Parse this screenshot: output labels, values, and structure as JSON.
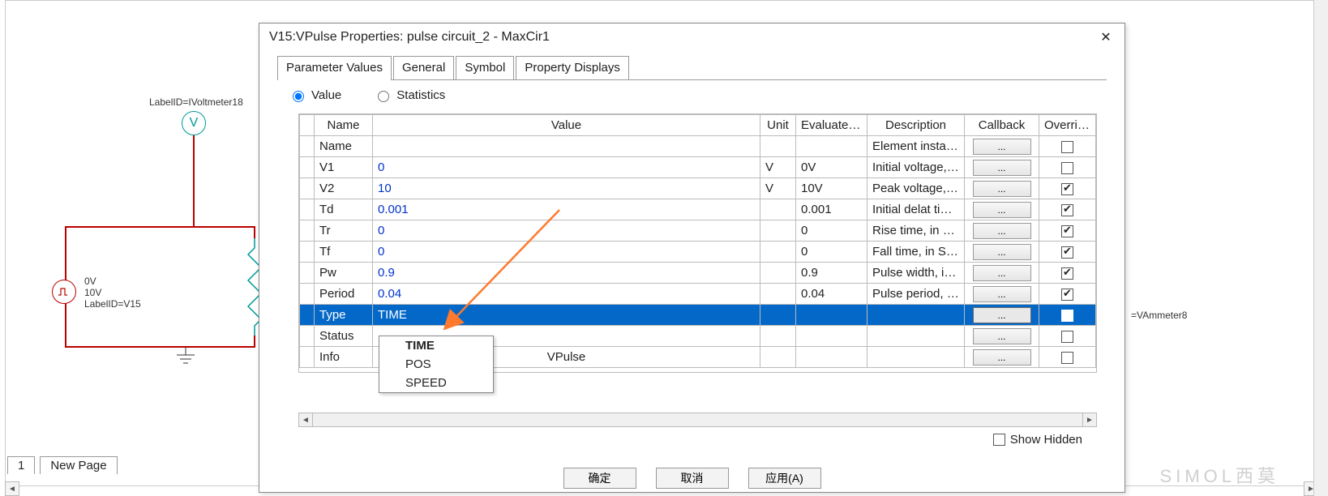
{
  "canvas": {
    "voltmeter_label": "LabelID=IVoltmeter18",
    "voltmeter_symbol": "V",
    "source_lines": [
      "0V",
      "10V",
      "LabelID=V15"
    ],
    "vammeter_label": "=VAmmeter8"
  },
  "bottom_tabs": {
    "tab1": "1",
    "tab2": "New Page"
  },
  "watermark": "SIMOL西莫",
  "dialog": {
    "title": "V15:VPulse Properties: pulse circuit_2 - MaxCir1",
    "close": "✕",
    "tabs": {
      "t0": "Parameter Values",
      "t1": "General",
      "t2": "Symbol",
      "t3": "Property Displays"
    },
    "radios": {
      "value": "Value",
      "stats": "Statistics"
    },
    "headers": {
      "name": "Name",
      "value": "Value",
      "unit": "Unit",
      "eval": "Evaluated...",
      "desc": "Description",
      "cb": "Callback",
      "ovr": "Override"
    },
    "rows": [
      {
        "name": "Name",
        "value": "",
        "unit": "",
        "eval": "",
        "desc": "Element instan...",
        "cb": "...",
        "ovr": false,
        "blue": false
      },
      {
        "name": "V1",
        "value": "0",
        "unit": "V",
        "eval": "0V",
        "desc": "Initial voltage, ...",
        "cb": "...",
        "ovr": false,
        "blue": true
      },
      {
        "name": "V2",
        "value": "10",
        "unit": "V",
        "eval": "10V",
        "desc": "Peak voltage, i...",
        "cb": "...",
        "ovr": true,
        "blue": true
      },
      {
        "name": "Td",
        "value": "0.001",
        "unit": "",
        "eval": "0.001",
        "desc": "Initial delat tim...",
        "cb": "...",
        "ovr": true,
        "blue": true
      },
      {
        "name": "Tr",
        "value": "0",
        "unit": "",
        "eval": "0",
        "desc": "Rise time, in S...",
        "cb": "...",
        "ovr": true,
        "blue": true
      },
      {
        "name": "Tf",
        "value": "0",
        "unit": "",
        "eval": "0",
        "desc": "Fall time, in Se...",
        "cb": "...",
        "ovr": true,
        "blue": true
      },
      {
        "name": "Pw",
        "value": "0.9",
        "unit": "",
        "eval": "0.9",
        "desc": "Pulse width, in ...",
        "cb": "...",
        "ovr": true,
        "blue": true
      },
      {
        "name": "Period",
        "value": "0.04",
        "unit": "",
        "eval": "0.04",
        "desc": "Pulse period, i...",
        "cb": "...",
        "ovr": true,
        "blue": true
      },
      {
        "name": "Type",
        "value": "TIME",
        "unit": "",
        "eval": "",
        "desc": "",
        "cb": "...",
        "ovr": false,
        "blue": false,
        "selected": true
      },
      {
        "name": "Status",
        "value": "",
        "unit": "",
        "eval": "",
        "desc": "",
        "cb": "...",
        "ovr": false,
        "blue": false
      },
      {
        "name": "Info",
        "value": "VPulse",
        "unit": "",
        "eval": "",
        "desc": "",
        "cb": "...",
        "ovr": false,
        "blue": false,
        "valStyle": "center"
      }
    ],
    "dropdown": {
      "opt0": "TIME",
      "opt1": "POS",
      "opt2": "SPEED"
    },
    "show_hidden": "Show Hidden",
    "buttons": {
      "ok": "确定",
      "cancel": "取消",
      "apply": "应用(A)"
    }
  }
}
